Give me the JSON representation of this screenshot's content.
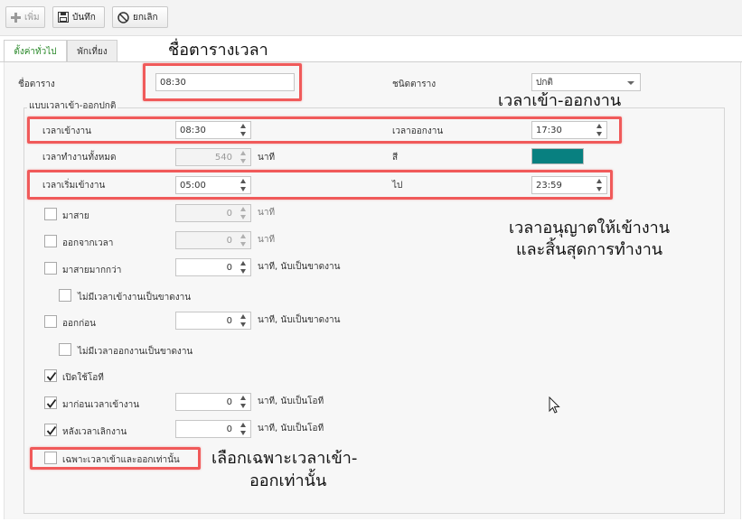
{
  "toolbar": {
    "add_label": "เพิ่ม",
    "save_label": "บันทึก",
    "cancel_label": "ยกเลิก"
  },
  "tabs": [
    {
      "label": "ตั้งค่าทั่วไป",
      "active": true
    },
    {
      "label": "พักเที่ยง",
      "active": false
    }
  ],
  "form": {
    "schedule_name_label": "ชื่อตาราง",
    "schedule_name_value": "08:30",
    "schedule_type_label": "ชนิดตาราง",
    "schedule_type_value": "ปกติ",
    "group_title": "แบบเวลาเข้า-ออกปกติ",
    "clock_in_label": "เวลาเข้างาน",
    "clock_in_value": "08:30",
    "clock_out_label": "เวลาออกงาน",
    "clock_out_value": "17:30",
    "total_work_label": "เวลาทำงานทั้งหมด",
    "total_work_value": "540",
    "total_work_unit": "นาที",
    "color_label": "สี",
    "color_value": "#088080",
    "start_label": "เวลาเริ่มเข้างาน",
    "start_value": "05:00",
    "to_label": "ไป",
    "to_value": "23:59"
  },
  "options": {
    "late": {
      "label": "มาสาย",
      "value": "0",
      "unit": "นาที",
      "checked": false
    },
    "leave_early_time": {
      "label": "ออกจากเวลา",
      "value": "0",
      "unit": "นาที",
      "checked": false
    },
    "late_more_than": {
      "label": "มาสายมากกว่า",
      "value": "0",
      "unit": "นาที, นับเป็นขาดงาน",
      "checked": false
    },
    "no_clock_in_absent": {
      "label": "ไม่มีเวลาเข้างานเป็นขาดงาน",
      "checked": false
    },
    "leave_before": {
      "label": "ออกก่อน",
      "value": "0",
      "unit": "นาที, นับเป็นขาดงาน",
      "checked": false
    },
    "no_clock_out_absent": {
      "label": "ไม่มีเวลาออกงานเป็นขาดงาน",
      "checked": false
    },
    "enable_ot": {
      "label": "เปิดใช้โอที",
      "checked": true
    },
    "before_clock_in": {
      "label": "มาก่อนเวลาเข้างาน",
      "value": "0",
      "unit": "นาที, นับเป็นโอที",
      "checked": true
    },
    "after_clock_out": {
      "label": "หลังเวลาเลิกงาน",
      "value": "0",
      "unit": "นาที, นับเป็นโอที",
      "checked": true
    },
    "only_in_out": {
      "label": "เฉพาะเวลาเข้าและออกเท่านั้น",
      "checked": false
    }
  },
  "annotations": {
    "schedule_name": "ชื่อตารางเวลา",
    "in_out_time": "เวลาเข้า-ออกงาน",
    "allowed_line1": "เวลาอนุญาตให้เข้างาน",
    "allowed_line2": "และสิ้นสุดการทำงาน",
    "only_line1": "เลือกเฉพาะเวลาเข้า-",
    "only_line2": "ออกเท่านั้น"
  },
  "colors": {
    "highlight": "#f05a5a",
    "active_tab_text": "#2b8a2b"
  }
}
